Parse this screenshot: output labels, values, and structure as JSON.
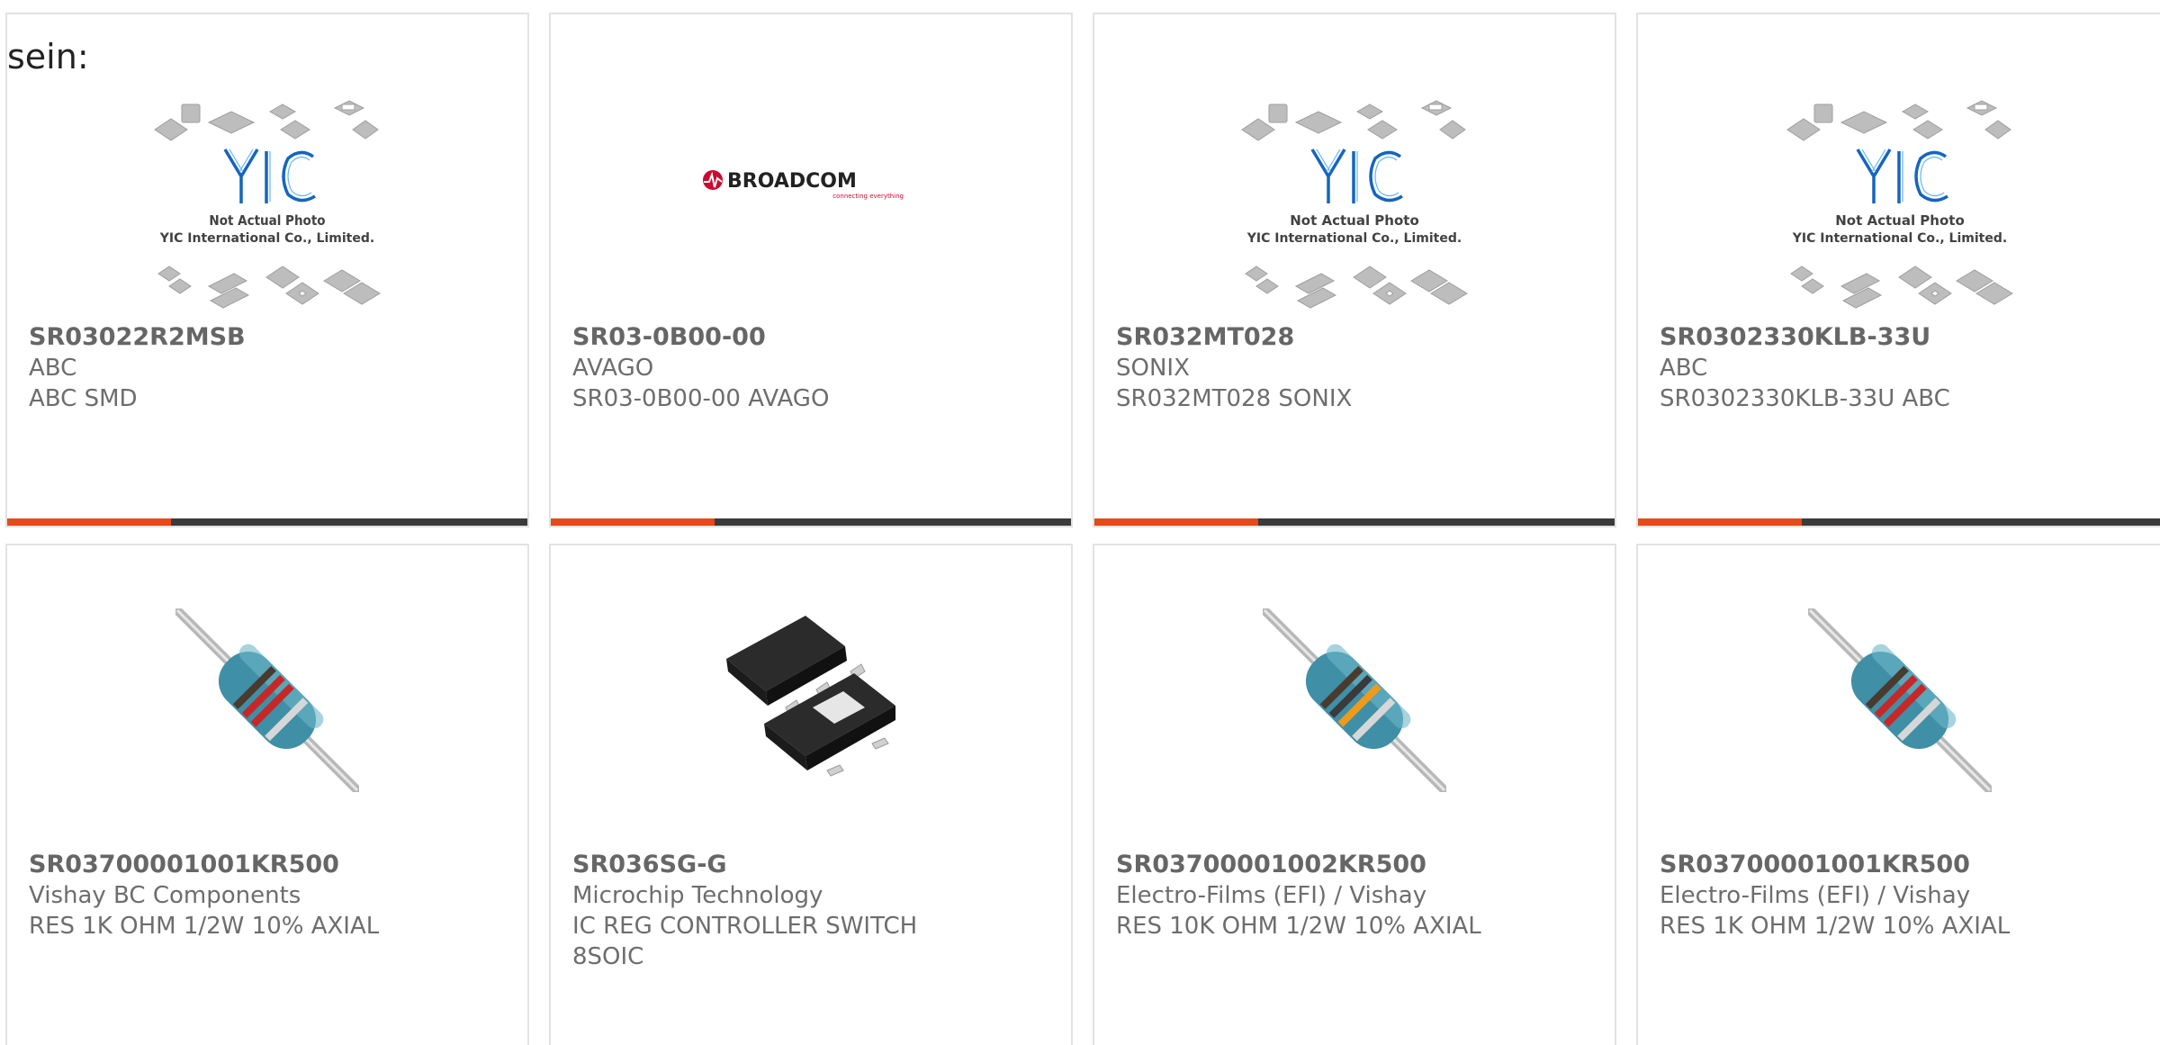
{
  "intro_text": "sein:",
  "colors": {
    "accent": "#e64a19",
    "bar_dark": "#3b3b3b",
    "text": "#6d6d6d",
    "border": "#e2e2e2"
  },
  "products": [
    {
      "part_number": "SR03022R2MSB",
      "manufacturer": "ABC",
      "description": "ABC SMD",
      "image": "yic-placeholder",
      "placeholder_lines": [
        "Not Actual Photo",
        "YIC International Co., Limited."
      ]
    },
    {
      "part_number": "SR03-0B00-00",
      "manufacturer": "AVAGO",
      "description": "SR03-0B00-00 AVAGO",
      "image": "broadcom-logo",
      "logo_text": "BROADCOM",
      "logo_tagline": "connecting everything"
    },
    {
      "part_number": "SR032MT028",
      "manufacturer": "SONIX",
      "description": "SR032MT028 SONIX",
      "image": "yic-placeholder",
      "placeholder_lines": [
        "Not Actual Photo",
        "YIC International Co., Limited."
      ]
    },
    {
      "part_number": "SR0302330KLB-33U",
      "manufacturer": "ABC",
      "description": "SR0302330KLB-33U ABC",
      "image": "yic-placeholder",
      "placeholder_lines": [
        "Not Actual Photo",
        "YIC International Co., Limited."
      ]
    },
    {
      "part_number": "SR03700001001KR500",
      "manufacturer": "Vishay BC Components",
      "description": "RES 1K OHM 1/2W 10% AXIAL",
      "image": "axial-resistor"
    },
    {
      "part_number": "SR036SG-G",
      "manufacturer": "Microchip Technology",
      "description": "IC REG CONTROLLER SWITCH 8SOIC",
      "image": "soic8-chip"
    },
    {
      "part_number": "SR03700001002KR500",
      "manufacturer": "Electro-Films (EFI) / Vishay",
      "description": "RES 10K OHM 1/2W 10% AXIAL",
      "image": "axial-resistor"
    },
    {
      "part_number": "SR03700001001KR500",
      "manufacturer": "Electro-Films (EFI) / Vishay",
      "description": "RES 1K OHM 1/2W 10% AXIAL",
      "image": "axial-resistor"
    }
  ]
}
